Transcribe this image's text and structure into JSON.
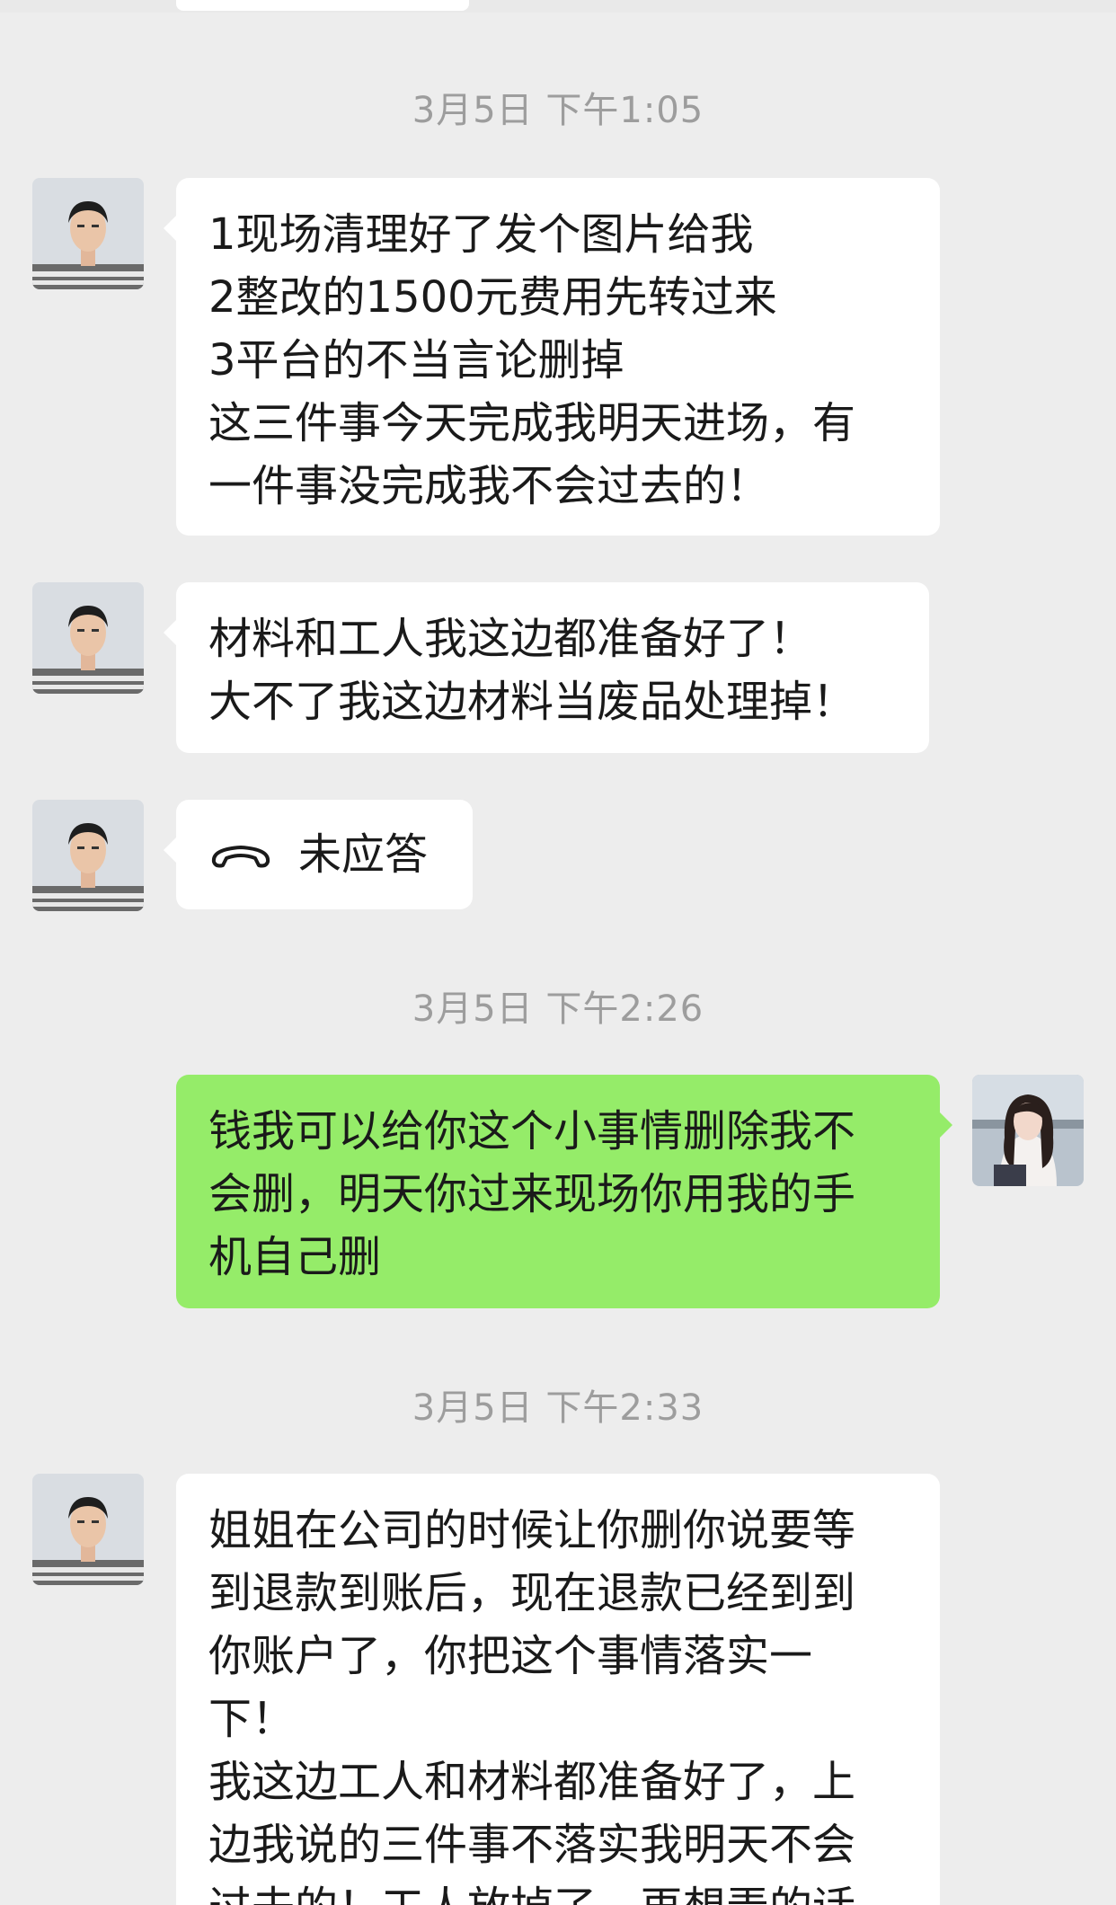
{
  "timestamps": [
    "3月5日 下午1:05",
    "3月5日 下午2:26",
    "3月5日 下午2:33"
  ],
  "messages": [
    {
      "sender": "contact",
      "lines": [
        "1现场清理好了发个图片给我",
        "2整改的1500元费用先转过来",
        "3平台的不当言论删掉",
        "这三件事今天完成我明天进场，有",
        "一件事没完成我不会过去的！"
      ]
    },
    {
      "sender": "contact",
      "lines": [
        "材料和工人我这边都准备好了！",
        "大不了我这边材料当废品处理掉！"
      ]
    },
    {
      "sender": "contact",
      "type": "call",
      "icon": "phone-hangup-icon",
      "text": "未应答"
    },
    {
      "sender": "me",
      "lines": [
        "钱我可以给你这个小事情删除我不",
        "会删，明天你过来现场你用我的手",
        "机自己删"
      ]
    },
    {
      "sender": "contact",
      "lines": [
        "姐姐在公司的时候让你删你说要等",
        "到退款到账后，现在退款已经到到",
        "你账户了，你把这个事情落实一",
        "下！",
        "我这边工人和材料都准备好了，上",
        "边我说的三件事不落实我明天不会",
        "过去的！工人放掉了，再想弄的话"
      ]
    }
  ],
  "colors": {
    "background": "#ededed",
    "incoming_bubble": "#ffffff",
    "outgoing_bubble": "#95ec69",
    "timestamp_text": "#9d9d9d",
    "message_text": "#1a1a1a"
  }
}
